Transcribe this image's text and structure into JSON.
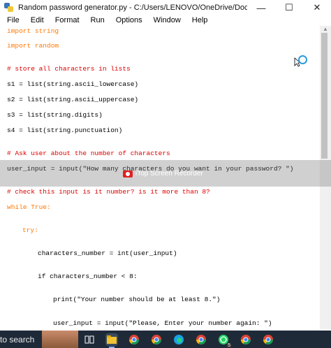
{
  "window": {
    "title": "Random password generator.py - C:/Users/LENOVO/OneDrive/Documents/Python Scripts/R...",
    "minimize": "—",
    "maximize": "☐",
    "close": "✕"
  },
  "menu": [
    "File",
    "Edit",
    "Format",
    "Run",
    "Options",
    "Window",
    "Help"
  ],
  "code": {
    "l1": "import string",
    "l2": "import random",
    "l3": "# store all characters in lists",
    "l4": "s1 = list(string.ascii_lowercase)",
    "l5": "s2 = list(string.ascii_uppercase)",
    "l6": "s3 = list(string.digits)",
    "l7": "s4 = list(string.punctuation)",
    "l8": "# Ask user about the number of characters",
    "l9": "user_input = input(\"How many characters do you want in your password? \")",
    "l10": "# check this input is it number? is it more than 8?",
    "l11": "while True:",
    "l12": "try:",
    "l13": "characters_number = int(user_input)",
    "l14": "if characters_number < 8:",
    "l15": "print(\"Your number should be at least 8.\")",
    "l16": "user_input = input(\"Please, Enter your number again: \")"
  },
  "overlay": {
    "recorder_label": "iTop Screen Recorder"
  },
  "taskbar": {
    "search_text": "to search",
    "teams_badge": "5"
  },
  "colors": {
    "keyword": "#ff7700",
    "string": "#00aa00",
    "comment": "#dd0000",
    "builtin": "#900090"
  }
}
